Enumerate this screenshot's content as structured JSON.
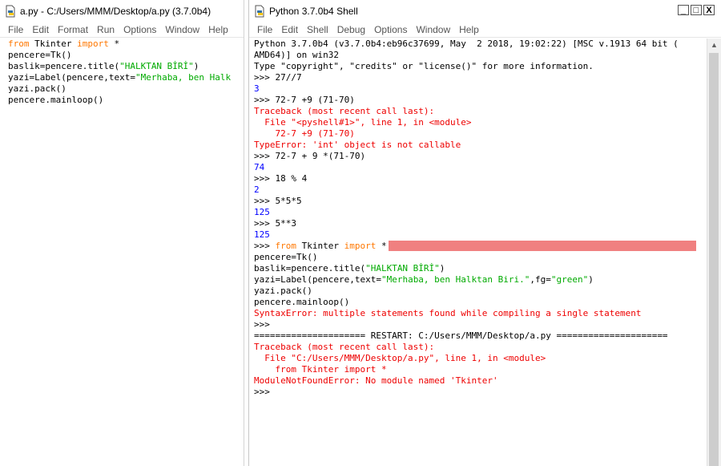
{
  "editor": {
    "title": "a.py - C:/Users/MMM/Desktop/a.py (3.7.0b4)",
    "menu": [
      "File",
      "Edit",
      "Format",
      "Run",
      "Options",
      "Window",
      "Help"
    ],
    "code": [
      [
        [
          "kw",
          "from"
        ],
        [
          "t",
          " Tkinter "
        ],
        [
          "kw",
          "import"
        ],
        [
          "t",
          " *"
        ]
      ],
      [
        [
          "t",
          "pencere=Tk()"
        ]
      ],
      [
        [
          "t",
          "baslik=pencere.title("
        ],
        [
          "str",
          "\"HALKTAN BİRİ\""
        ],
        [
          "t",
          ")"
        ]
      ],
      [
        [
          "t",
          "yazi=Label(pencere,text="
        ],
        [
          "str",
          "\"Merhaba, ben Halk"
        ]
      ],
      [
        [
          "t",
          "yazi.pack()"
        ]
      ],
      [
        [
          "t",
          "pencere.mainloop()"
        ]
      ]
    ]
  },
  "shell": {
    "title": "Python 3.7.0b4 Shell",
    "menu": [
      "File",
      "Edit",
      "Shell",
      "Debug",
      "Options",
      "Window",
      "Help"
    ],
    "buttons": {
      "minimize": "_",
      "maximize": "□",
      "close": "X"
    },
    "lines": [
      [
        [
          "t",
          "Python 3.7.0b4 (v3.7.0b4:eb96c37699, May  2 2018, 19:02:22) [MSC v.1913 64 bit ("
        ]
      ],
      [
        [
          "t",
          "AMD64)] on win32"
        ]
      ],
      [
        [
          "t",
          "Type \"copyright\", \"credits\" or \"license()\" for more information."
        ]
      ],
      [
        [
          "t",
          ">>> 27//7"
        ]
      ],
      [
        [
          "out",
          "3"
        ]
      ],
      [
        [
          "t",
          ">>> 72-7 +9 (71-70)"
        ]
      ],
      [
        [
          "err",
          "Traceback (most recent call last):"
        ]
      ],
      [
        [
          "err",
          "  File \"<pyshell#1>\", line 1, in <module>"
        ]
      ],
      [
        [
          "err",
          "    72-7 +9 (71-70)"
        ]
      ],
      [
        [
          "err",
          "TypeError: 'int' object is not callable"
        ]
      ],
      [
        [
          "t",
          ">>> 72-7 + 9 *(71-70)"
        ]
      ],
      [
        [
          "out",
          "74"
        ]
      ],
      [
        [
          "t",
          ">>> 18 % 4"
        ]
      ],
      [
        [
          "out",
          "2"
        ]
      ],
      [
        [
          "t",
          ">>> 5*5*5"
        ]
      ],
      [
        [
          "out",
          "125"
        ]
      ],
      [
        [
          "t",
          ">>> 5**3"
        ]
      ],
      [
        [
          "out",
          "125"
        ]
      ],
      [
        [
          "t",
          ">>> "
        ],
        [
          "kw",
          "from"
        ],
        [
          "t",
          " Tkinter "
        ],
        [
          "kw",
          "import"
        ],
        [
          "t",
          " *"
        ],
        [
          "hl",
          ""
        ]
      ],
      [
        [
          "t",
          "pencere=Tk()"
        ]
      ],
      [
        [
          "t",
          "baslik=pencere.title("
        ],
        [
          "str",
          "\"HALKTAN BİRİ\""
        ],
        [
          "t",
          ")"
        ]
      ],
      [
        [
          "t",
          "yazi=Label(pencere,text="
        ],
        [
          "str",
          "\"Merhaba, ben Halktan Biri.\""
        ],
        [
          "t",
          ",fg="
        ],
        [
          "str",
          "\"green\""
        ],
        [
          "t",
          ")"
        ]
      ],
      [
        [
          "t",
          "yazi.pack()"
        ]
      ],
      [
        [
          "t",
          "pencere.mainloop()"
        ]
      ],
      [
        [
          "err",
          "SyntaxError: multiple statements found while compiling a single statement"
        ]
      ],
      [
        [
          "t",
          ">>> "
        ]
      ],
      [
        [
          "t",
          "===================== RESTART: C:/Users/MMM/Desktop/a.py ====================="
        ]
      ],
      [
        [
          "err",
          "Traceback (most recent call last):"
        ]
      ],
      [
        [
          "err",
          "  File \"C:/Users/MMM/Desktop/a.py\", line 1, in <module>"
        ]
      ],
      [
        [
          "err",
          "    from Tkinter import *"
        ]
      ],
      [
        [
          "err",
          "ModuleNotFoundError: No module named 'Tkinter'"
        ]
      ],
      [
        [
          "t",
          ">>> "
        ]
      ]
    ]
  },
  "colors": {
    "keyword": "#ff7700",
    "string": "#00aa00",
    "output": "#0000ff",
    "error": "#ee0000",
    "highlight": "#f08080"
  },
  "icons": {
    "editor": "python-file-icon",
    "shell": "python-shell-icon"
  }
}
